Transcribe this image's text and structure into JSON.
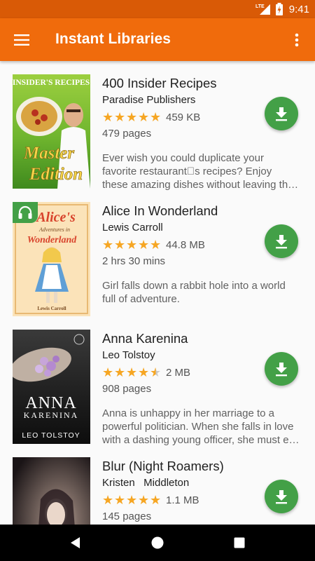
{
  "status_bar": {
    "network": "LTE",
    "time": "9:41"
  },
  "app_bar": {
    "title": "Instant Libraries",
    "menu_icon": "hamburger-menu-icon",
    "overflow_icon": "more-vert-icon"
  },
  "colors": {
    "primary": "#f06b0c",
    "primary_dark": "#d95a06",
    "accent_green": "#43a047",
    "star": "#f6a623"
  },
  "books": [
    {
      "title": "400 Insider Recipes",
      "author": "Paradise Publishers",
      "rating": 5,
      "size": "459 KB",
      "length": "479 pages",
      "description_lines": [
        "Ever wish you could duplicate your",
        "favorite restaurant\u0000s recipes? Enjoy",
        "these amazing dishes without leaving th…"
      ],
      "cover_text": [
        "INSIDER'S RECIPES",
        "Master",
        "Edition"
      ],
      "audio": false
    },
    {
      "title": "Alice In Wonderland",
      "author": "Lewis Carroll",
      "rating": 5,
      "size": "44.8 MB",
      "length": "2 hrs 30 mins",
      "description_lines": [
        "Girl falls down a rabbit hole into a world",
        "full of adventure."
      ],
      "cover_text": [
        "Alice's",
        "Adventures in",
        "Wonderland",
        "Lewis Carroll"
      ],
      "audio": true
    },
    {
      "title": "Anna Karenina",
      "author": "Leo Tolstoy",
      "rating": 4.5,
      "size": "2 MB",
      "length": "908 pages",
      "description_lines": [
        "Anna is unhappy in her marriage to a",
        "powerful politician. When she falls in love",
        "with a dashing young officer, she must e…"
      ],
      "cover_text": [
        "ANNA",
        "KARENINA",
        "LEO TOLSTOY"
      ],
      "audio": false
    },
    {
      "title": "Blur (Night Roamers)",
      "author": "Kristen   Middleton",
      "rating": 5,
      "size": "1.1 MB",
      "length": "145 pages",
      "description_lines": [],
      "cover_text": [],
      "audio": false
    }
  ],
  "nav_bar": {
    "back_icon": "back-triangle-icon",
    "home_icon": "home-circle-icon",
    "recents_icon": "recents-square-icon"
  }
}
